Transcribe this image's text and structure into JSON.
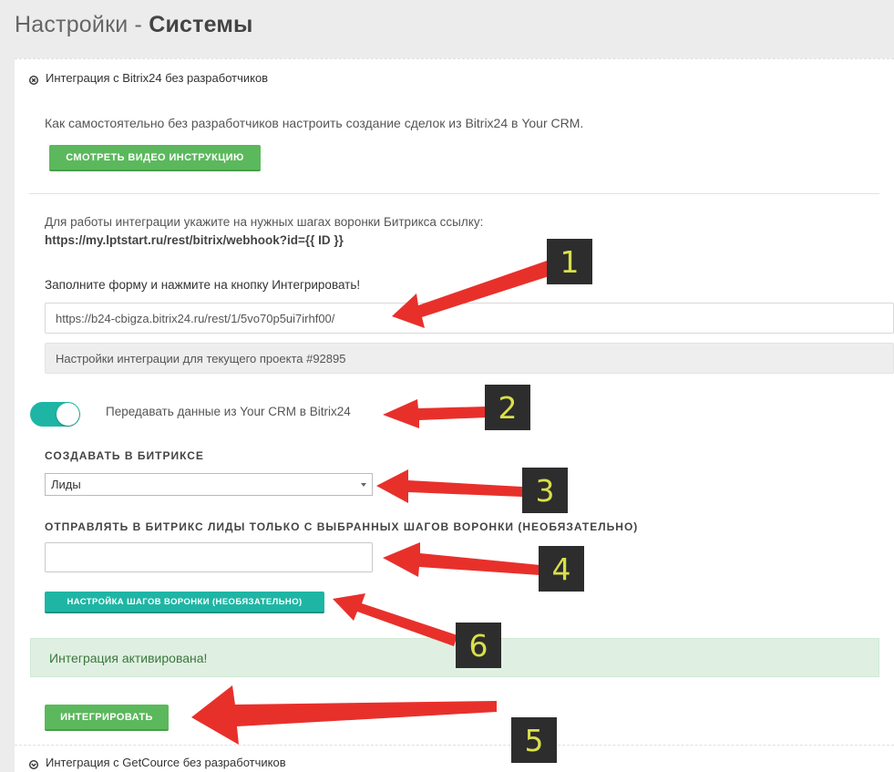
{
  "header": {
    "title_light": "Настройки - ",
    "title_bold": "Системы"
  },
  "bitrix_section": {
    "title": "Интеграция с Bitrix24 без разработчиков",
    "video_hint": "Как самостоятельно без разработчиков настроить создание сделок из Bitrix24 в Your CRM.",
    "video_button": "Смотреть видео инструкцию",
    "webhook_hint": "Для работы интеграции укажите на нужных шагах воронки Битрикса ссылку:",
    "webhook_url": "https://my.lptstart.ru/rest/bitrix/webhook?id={{ ID }}",
    "form_hint": "Заполните форму и нажмите на кнопку Интегрировать!",
    "bitrix_url_value": "https://b24-cbigza.bitrix24.ru/rest/1/5vo70p5ui7irhf00/",
    "project_settings": "Настройки интеграции для текущего проекта #92895",
    "toggle_label": "Передавать данные из Your CRM в Bitrix24",
    "toggle_on": true,
    "create_label": "Создавать в Битриксе",
    "create_selected": "Лиды",
    "steps_label": "Отправлять в Битрикс лиды только с выбранных шагов воронки (необязательно)",
    "steps_value": "",
    "steps_button": "Настройка шагов воронки (необязательно)",
    "alert_text": "Интеграция активирована!",
    "integrate_button": "Интегрировать"
  },
  "getcource_section": {
    "title": "Интеграция с GetCource без разработчиков"
  },
  "callouts": [
    "1",
    "2",
    "3",
    "4",
    "5",
    "6"
  ],
  "colors": {
    "green": "#5cb85c",
    "teal": "#1fb5a4",
    "arrow": "#e8302b",
    "callout_bg": "#2d2d2d",
    "callout_text": "#d8e04a",
    "alert_bg": "#dff0e2"
  }
}
